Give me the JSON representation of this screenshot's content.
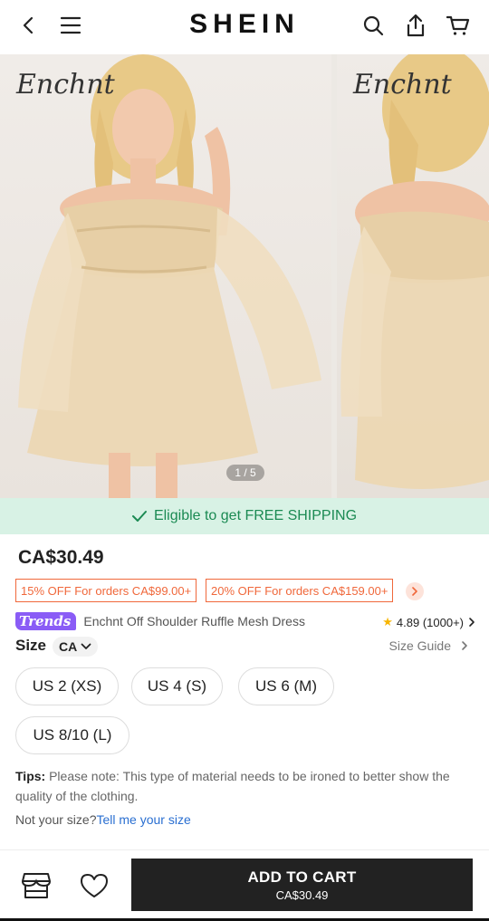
{
  "header": {
    "logo": "SHEIN",
    "icons": [
      "back-icon",
      "menu-icon",
      "search-icon",
      "share-icon",
      "cart-icon"
    ]
  },
  "gallery": {
    "brand_watermark": "Enchnt",
    "page_indicator": "1 / 5"
  },
  "shipping_banner": {
    "text": "Eligible to get FREE SHIPPING"
  },
  "product": {
    "price": "CA$30.49",
    "coupons": [
      "15% OFF For orders CA$99.00+",
      "20% OFF For orders CA$159.00+"
    ],
    "badge": "Trends",
    "title": "Enchnt Off Shoulder Ruffle Mesh Dress",
    "rating": "4.89 (1000+)"
  },
  "size": {
    "label": "Size",
    "region": "CA",
    "guide_label": "Size Guide",
    "options": [
      "US 2 (XS)",
      "US 4 (S)",
      "US 6 (M)",
      "US 8/10 (L)"
    ]
  },
  "tips": {
    "label": "Tips:",
    "text": " Please note: This type of material needs to be ironed to better show the quality of the clothing."
  },
  "not_your_size": {
    "prefix": "Not your size?",
    "link": "Tell me your size"
  },
  "bottom_bar": {
    "add_to_cart": "ADD TO CART",
    "price": "CA$30.49"
  },
  "colors": {
    "accent_orange": "#f0683b",
    "shipping_green": "#1b8a53",
    "shipping_bg": "#d8f2e5",
    "trends_purple": "#8a5cf6",
    "cart_button": "#222222"
  }
}
